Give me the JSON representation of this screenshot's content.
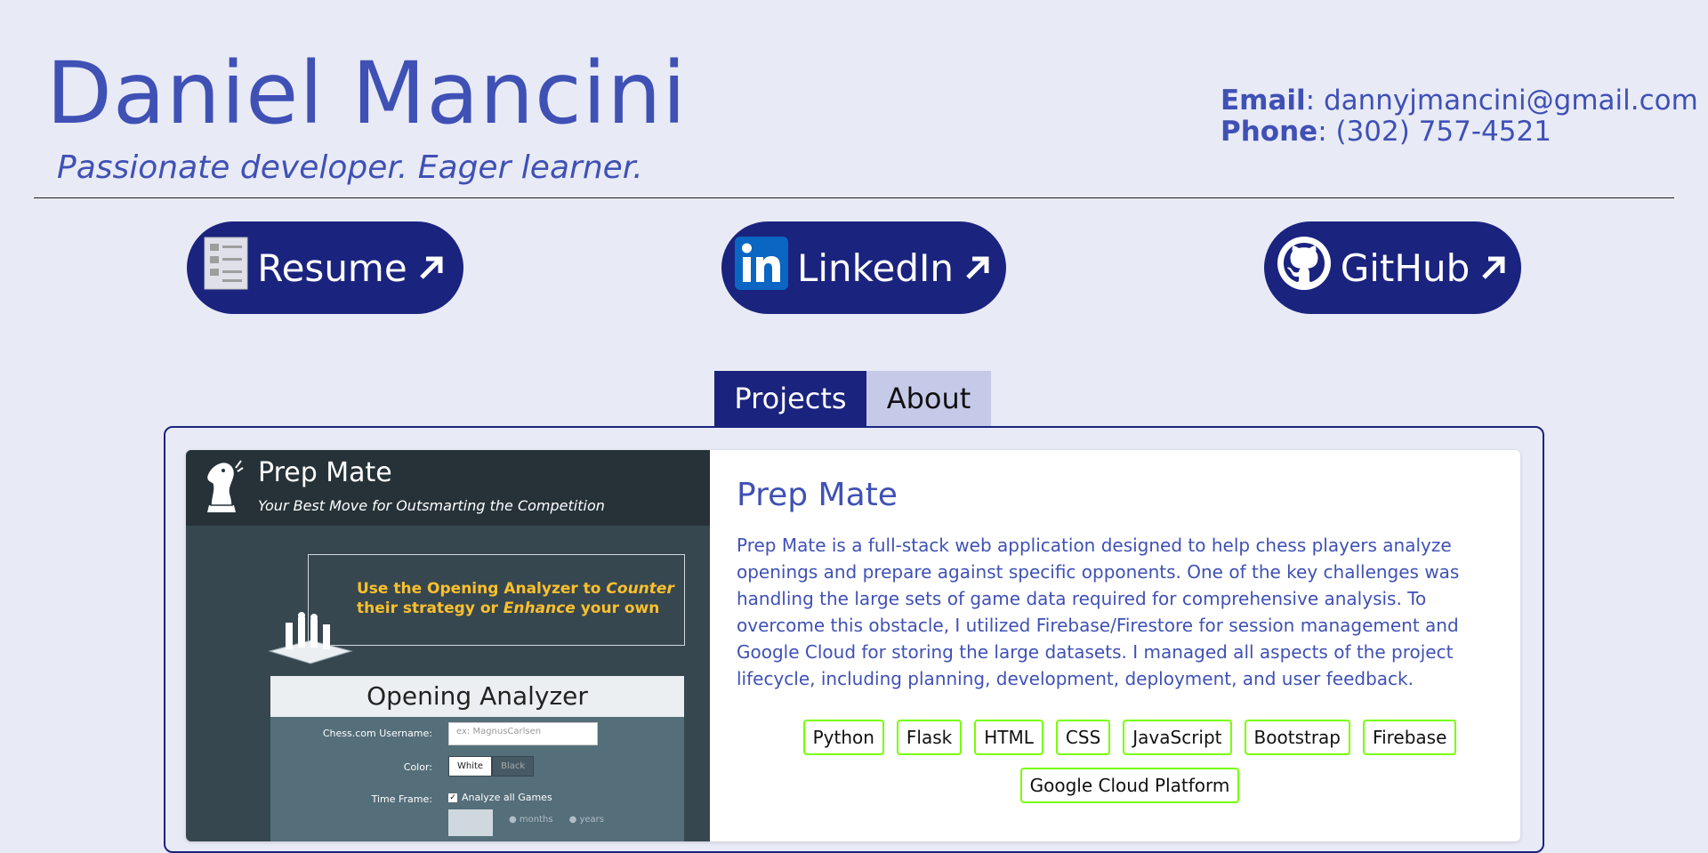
{
  "header": {
    "name": "Daniel Mancini",
    "tagline": "Passionate developer. Eager learner.",
    "email_label": "Email",
    "email_value": ": dannyjmancini@gmail.com",
    "phone_label": "Phone",
    "phone_value": ": (302) 757-4521"
  },
  "links": [
    {
      "label": "Resume",
      "icon": "document-icon"
    },
    {
      "label": "LinkedIn",
      "icon": "linkedin-icon"
    },
    {
      "label": "GitHub",
      "icon": "github-icon"
    }
  ],
  "tabs": [
    {
      "label": "Projects",
      "active": true
    },
    {
      "label": "About",
      "active": false
    }
  ],
  "project": {
    "title": "Prep Mate",
    "description": "Prep Mate is a full-stack web application designed to help chess players analyze openings and prepare against specific opponents. One of the key challenges was handling the large sets of game data required for comprehensive analysis. To overcome this obstacle, I utilized Firebase/Firestore for session management and Google Cloud for storing the large datasets. I managed all aspects of the project lifecycle, including planning, development, deployment, and user feedback.",
    "tags": [
      "Python",
      "Flask",
      "HTML",
      "CSS",
      "JavaScript",
      "Bootstrap",
      "Firebase",
      "Google Cloud Platform"
    ],
    "screenshot": {
      "app_title": "Prep Mate",
      "app_subtitle": "Your Best Move for Outsmarting the Competition",
      "promo_line1_a": "Use the Opening Analyzer to ",
      "promo_line1_b": "Counter",
      "promo_line2_a": "their strategy or ",
      "promo_line2_b": "Enhance",
      "promo_line2_c": " your own",
      "analyzer_title": "Opening Analyzer",
      "username_label": "Chess.com Username:",
      "username_placeholder": "ex: MagnusCarlsen",
      "color_label": "Color:",
      "color_white": "White",
      "color_black": "Black",
      "timeframe_label": "Time Frame:",
      "analyze_all": "Analyze all Games",
      "months": "months",
      "years": "years"
    }
  },
  "colors": {
    "background": "#e8eaf6",
    "primary": "#3f51b5",
    "dark": "#1a237e",
    "tag_border": "#76ff03"
  }
}
